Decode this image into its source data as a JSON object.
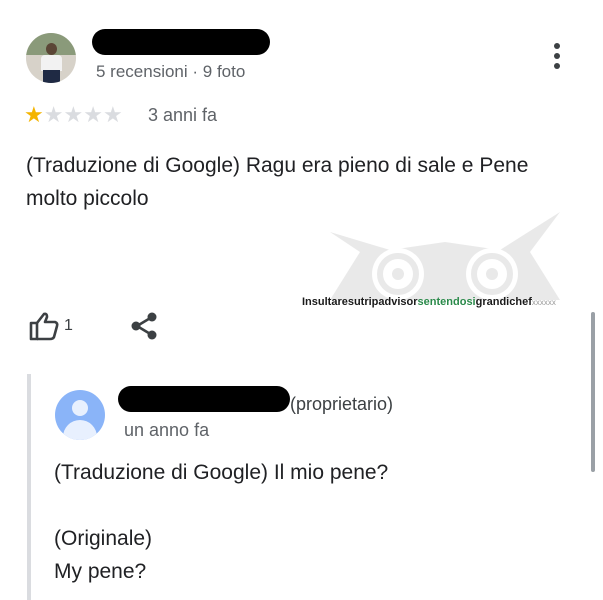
{
  "review": {
    "meta": "5 recensioni · 9 foto",
    "rating": 1,
    "max_rating": 5,
    "time": "3 anni fa",
    "text": "(Traduzione di Google) Ragu era pieno di sale e Pene molto piccolo",
    "likes": "1"
  },
  "watermark": {
    "part1": "Insultaresutripadvisor",
    "part2": "sentendosi",
    "part3": "grandichef",
    "part4": "xxxxxx"
  },
  "reply": {
    "owner_tag": "(proprietario)",
    "time": "un anno fa",
    "text": "(Traduzione di Google) Il mio pene?\n\n(Originale)\nMy pene?"
  },
  "icons": {
    "more": "more-vert-icon",
    "like": "thumb-up-icon",
    "share": "share-icon",
    "star": "star-icon"
  },
  "colors": {
    "star_filled": "#f4b400",
    "star_empty": "#dadce0",
    "secondary_text": "#5f6368",
    "reply_avatar": "#8ab4f8"
  }
}
